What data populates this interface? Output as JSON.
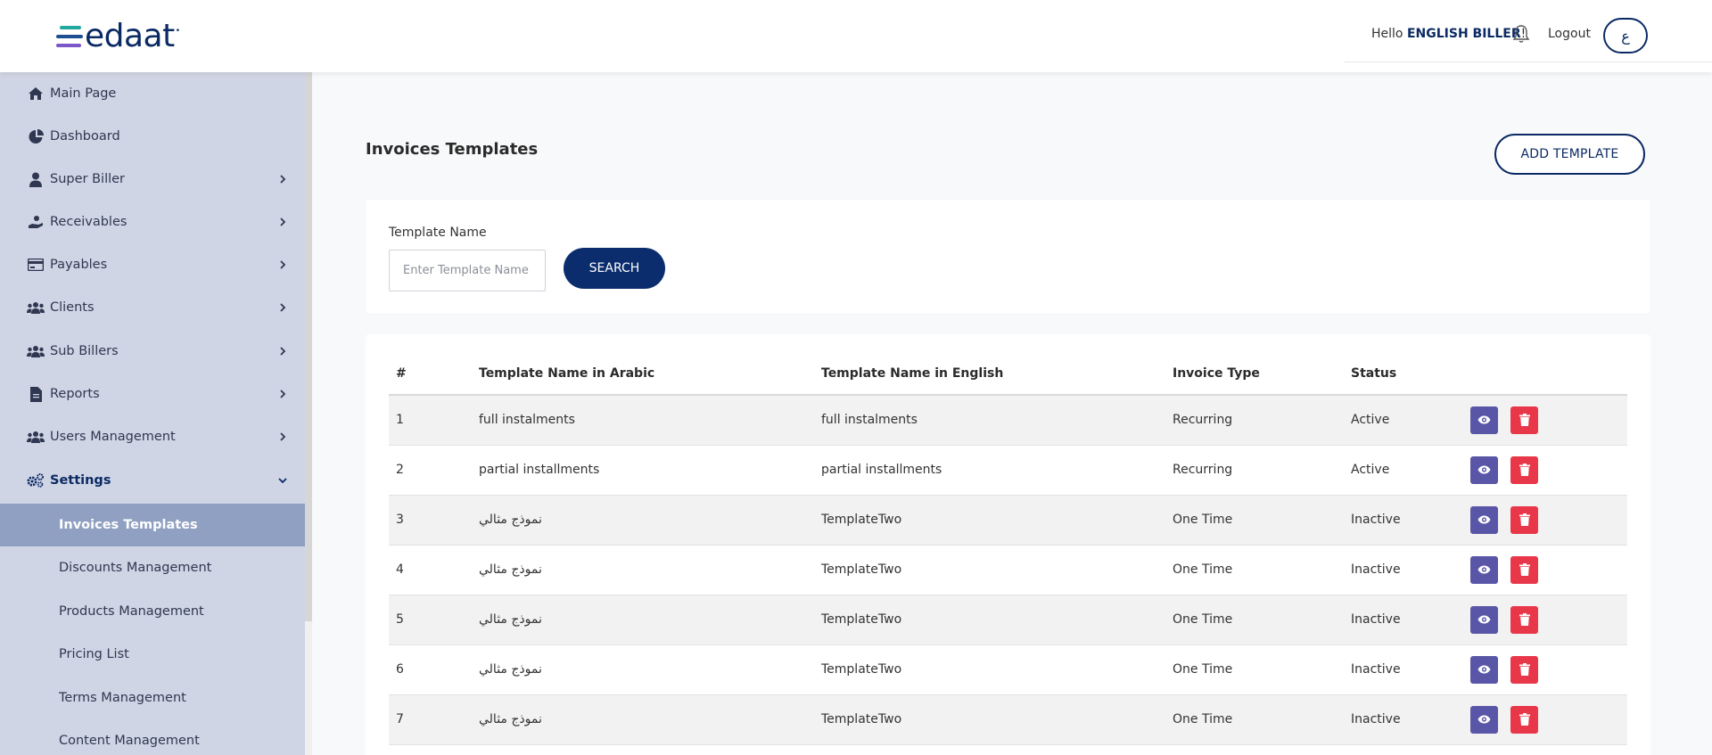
{
  "header": {
    "logo_text": "edaat",
    "logo_mark": "•",
    "greeting_prefix": "Hello",
    "user_name": "ENGLISH BILLER",
    "greeting_suffix": "!",
    "logout_label": "Logout",
    "language_label": "ع"
  },
  "sidebar": {
    "items": [
      {
        "label": "Main Page",
        "icon": "home-icon"
      },
      {
        "label": "Dashboard",
        "icon": "pie-chart-icon"
      },
      {
        "label": "Super Biller",
        "icon": "user-icon"
      },
      {
        "label": "Receivables",
        "icon": "hand-coin-icon"
      },
      {
        "label": "Payables",
        "icon": "credit-card-icon"
      },
      {
        "label": "Clients",
        "icon": "users-icon"
      },
      {
        "label": "Sub Billers",
        "icon": "users-icon"
      },
      {
        "label": "Reports",
        "icon": "file-icon"
      },
      {
        "label": "Users Management",
        "icon": "users-icon"
      },
      {
        "label": "Settings",
        "icon": "cogs-icon"
      }
    ],
    "settings_children": [
      {
        "label": "Invoices Templates"
      },
      {
        "label": "Discounts Management"
      },
      {
        "label": "Products Management"
      },
      {
        "label": "Pricing List"
      },
      {
        "label": "Terms Management"
      },
      {
        "label": "Content Management"
      }
    ]
  },
  "main": {
    "title": "Invoices Templates",
    "add_button": "ADD TEMPLATE",
    "search": {
      "label": "Template Name",
      "placeholder": "Enter Template Name",
      "value": "",
      "button": "SEARCH"
    },
    "table": {
      "headers": [
        "#",
        "Template Name in Arabic",
        "Template Name in English",
        "Invoice Type",
        "Status",
        ""
      ],
      "rows": [
        {
          "num": "1",
          "ar": "full instalments",
          "en": "full instalments",
          "type": "Recurring",
          "status": "Active"
        },
        {
          "num": "2",
          "ar": "partial installments",
          "en": "partial installments",
          "type": "Recurring",
          "status": "Active"
        },
        {
          "num": "3",
          "ar": "نموذج مثالي",
          "en": "TemplateTwo",
          "type": "One Time",
          "status": "Inactive"
        },
        {
          "num": "4",
          "ar": "نموذج مثالي",
          "en": "TemplateTwo",
          "type": "One Time",
          "status": "Inactive"
        },
        {
          "num": "5",
          "ar": "نموذج مثالي",
          "en": "TemplateTwo",
          "type": "One Time",
          "status": "Inactive"
        },
        {
          "num": "6",
          "ar": "نموذج مثالي",
          "en": "TemplateTwo",
          "type": "One Time",
          "status": "Inactive"
        },
        {
          "num": "7",
          "ar": "نموذج مثالي",
          "en": "TemplateTwo",
          "type": "One Time",
          "status": "Inactive"
        }
      ]
    }
  },
  "colors": {
    "brand_navy": "#0b2a63",
    "sidebar_bg": "#cfd5e4",
    "sidebar_selected": "#8fa0c2",
    "view_button": "#5a56a7",
    "delete_button": "#e9374a"
  }
}
